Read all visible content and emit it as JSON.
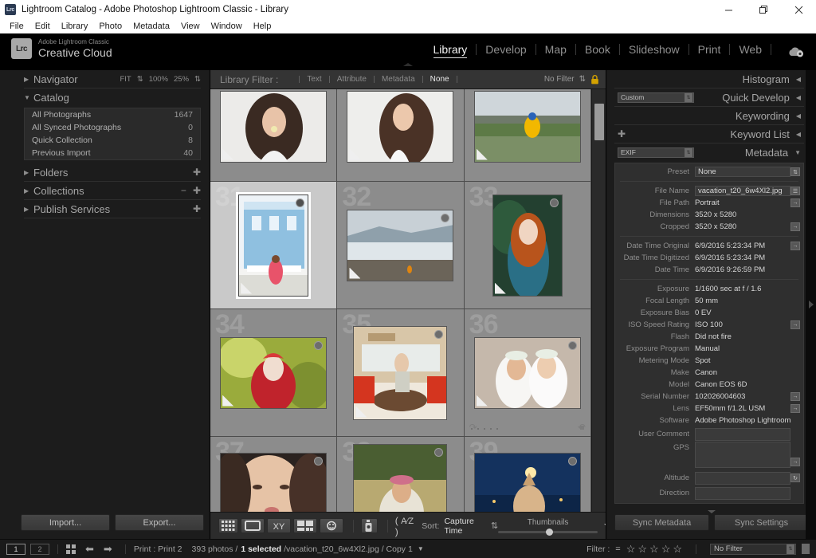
{
  "window": {
    "app_icon": "Lrc",
    "title": "Lightroom Catalog - Adobe Photoshop Lightroom Classic - Library",
    "minimize": "–",
    "restore": "❐",
    "close": "✕"
  },
  "menu": [
    "File",
    "Edit",
    "Library",
    "Photo",
    "Metadata",
    "View",
    "Window",
    "Help"
  ],
  "identity": {
    "badge": "Lrc",
    "line1": "Adobe Lightroom Classic",
    "line2": "Creative Cloud"
  },
  "modules": [
    {
      "label": "Library",
      "active": true
    },
    {
      "label": "Develop",
      "active": false
    },
    {
      "label": "Map",
      "active": false
    },
    {
      "label": "Book",
      "active": false
    },
    {
      "label": "Slideshow",
      "active": false
    },
    {
      "label": "Print",
      "active": false
    },
    {
      "label": "Web",
      "active": false
    }
  ],
  "cloud_icon": "cloud-sync-icon",
  "left_panel": {
    "navigator": {
      "title": "Navigator",
      "fit": "FIT",
      "zoom1": "100%",
      "zoom2": "25%"
    },
    "catalog": {
      "title": "Catalog",
      "rows": [
        {
          "label": "All Photographs",
          "count": "1647"
        },
        {
          "label": "All Synced Photographs",
          "count": "0"
        },
        {
          "label": "Quick Collection",
          "count": "8"
        },
        {
          "label": "Previous Import",
          "count": "40"
        }
      ]
    },
    "folders": "Folders",
    "collections": "Collections",
    "publish_services": "Publish Services",
    "import_button": "Import...",
    "export_button": "Export..."
  },
  "library_filter": {
    "label": "Library Filter :",
    "items": [
      {
        "label": "Text",
        "active": false
      },
      {
        "label": "Attribute",
        "active": false
      },
      {
        "label": "Metadata",
        "active": false
      },
      {
        "label": "None",
        "active": true
      }
    ],
    "preset": "No Filter",
    "lock_icon": "lock-icon"
  },
  "grid": {
    "cells": [
      {
        "index": "",
        "shape": "land",
        "selected": false,
        "badge": false,
        "show_index": false
      },
      {
        "index": "",
        "shape": "land",
        "selected": false,
        "badge": false,
        "show_index": false
      },
      {
        "index": "",
        "shape": "land",
        "selected": false,
        "badge": false,
        "show_index": false
      },
      {
        "index": "31",
        "shape": "port",
        "selected": true,
        "badge": true,
        "show_index": true
      },
      {
        "index": "32",
        "shape": "land",
        "selected": false,
        "badge": true,
        "show_index": true
      },
      {
        "index": "33",
        "shape": "port",
        "selected": false,
        "badge": true,
        "show_index": true
      },
      {
        "index": "34",
        "shape": "land",
        "selected": false,
        "badge": true,
        "show_index": true
      },
      {
        "index": "35",
        "shape": "sq",
        "selected": false,
        "badge": true,
        "show_index": true
      },
      {
        "index": "36",
        "shape": "land",
        "selected": false,
        "badge": true,
        "show_index": true,
        "rating": true,
        "rotate": true
      },
      {
        "index": "37",
        "shape": "land",
        "selected": false,
        "badge": true,
        "show_index": true
      },
      {
        "index": "38",
        "shape": "sq",
        "selected": false,
        "badge": true,
        "show_index": true
      },
      {
        "index": "39",
        "shape": "land",
        "selected": false,
        "badge": true,
        "show_index": true
      }
    ]
  },
  "toolbar": {
    "view_grid_icon": "grid-view-icon",
    "view_loupe_icon": "loupe-view-icon",
    "view_compare_icon": "compare-view-icon",
    "view_survey_icon": "survey-view-icon",
    "view_people_icon": "people-view-icon",
    "spray_icon": "spray-can-icon",
    "sort_direction_icon": "sort-az-icon",
    "sort_label": "Sort:",
    "sort_value": "Capture Time",
    "thumbnails_label": "Thumbnails"
  },
  "right_panel": {
    "histogram": "Histogram",
    "quick_develop": "Quick Develop",
    "quick_develop_preset": "Custom",
    "keywording": "Keywording",
    "keyword_list": "Keyword List",
    "metadata": "Metadata",
    "metadata_set": "EXIF",
    "preset_label": "Preset",
    "preset_value": "None",
    "fields": [
      {
        "label": "File Name",
        "value": "vacation_t20_6w4Xl2.jpg",
        "field": true,
        "button": "list"
      },
      {
        "label": "File Path",
        "value": "Portrait",
        "field": false,
        "button": "arrow"
      },
      {
        "label": "Dimensions",
        "value": "3520 x 5280",
        "field": false,
        "button": ""
      },
      {
        "label": "Cropped",
        "value": "3520 x 5280",
        "field": false,
        "button": "arrow"
      },
      {
        "label": "",
        "value": "",
        "divider": true
      },
      {
        "label": "Date Time Original",
        "value": "6/9/2016 5:23:34 PM",
        "field": false,
        "button": "arrow"
      },
      {
        "label": "Date Time Digitized",
        "value": "6/9/2016 5:23:34 PM",
        "field": false,
        "button": ""
      },
      {
        "label": "Date Time",
        "value": "6/9/2016 9:26:59 PM",
        "field": false,
        "button": ""
      },
      {
        "label": "",
        "value": "",
        "divider": true
      },
      {
        "label": "Exposure",
        "value": "1/1600 sec at f / 1.6",
        "field": false,
        "button": ""
      },
      {
        "label": "Focal Length",
        "value": "50 mm",
        "field": false,
        "button": ""
      },
      {
        "label": "Exposure Bias",
        "value": "0 EV",
        "field": false,
        "button": ""
      },
      {
        "label": "ISO Speed Rating",
        "value": "ISO 100",
        "field": false,
        "button": "arrow"
      },
      {
        "label": "Flash",
        "value": "Did not fire",
        "field": false,
        "button": ""
      },
      {
        "label": "Exposure Program",
        "value": "Manual",
        "field": false,
        "button": ""
      },
      {
        "label": "Metering Mode",
        "value": "Spot",
        "field": false,
        "button": ""
      },
      {
        "label": "Make",
        "value": "Canon",
        "field": false,
        "button": ""
      },
      {
        "label": "Model",
        "value": "Canon EOS 6D",
        "field": false,
        "button": ""
      },
      {
        "label": "Serial Number",
        "value": "102026004603",
        "field": false,
        "button": "arrow"
      },
      {
        "label": "Lens",
        "value": "EF50mm f/1.2L USM",
        "field": false,
        "button": "arrow"
      },
      {
        "label": "Software",
        "value": "Adobe Photoshop Lightroom S...",
        "field": false,
        "button": ""
      },
      {
        "label": "User Comment",
        "value": "",
        "field": true,
        "button": ""
      },
      {
        "label": "GPS",
        "value": "",
        "field": true,
        "button": "arrow"
      },
      {
        "label": "Altitude",
        "value": "",
        "field": true,
        "button": "refresh"
      },
      {
        "label": "Direction",
        "value": "",
        "field": true,
        "button": ""
      }
    ],
    "sync_metadata": "Sync Metadata",
    "sync_settings": "Sync Settings"
  },
  "status_bar": {
    "page1": "1",
    "page2": "2",
    "grid_icon": "grid-toggle-icon",
    "prev_icon": "previous-arrow-icon",
    "next_icon": "next-arrow-icon",
    "print_label": "Print : Print 2",
    "photo_count": "393 photos /",
    "selected": "1 selected",
    "filename": "/vacation_t20_6w4Xl2.jpg / Copy 1",
    "filter_label": "Filter :",
    "filter_op": "=",
    "stars": [
      "☆",
      "☆",
      "☆",
      "☆",
      "☆"
    ],
    "filter_preset": "No Filter"
  }
}
